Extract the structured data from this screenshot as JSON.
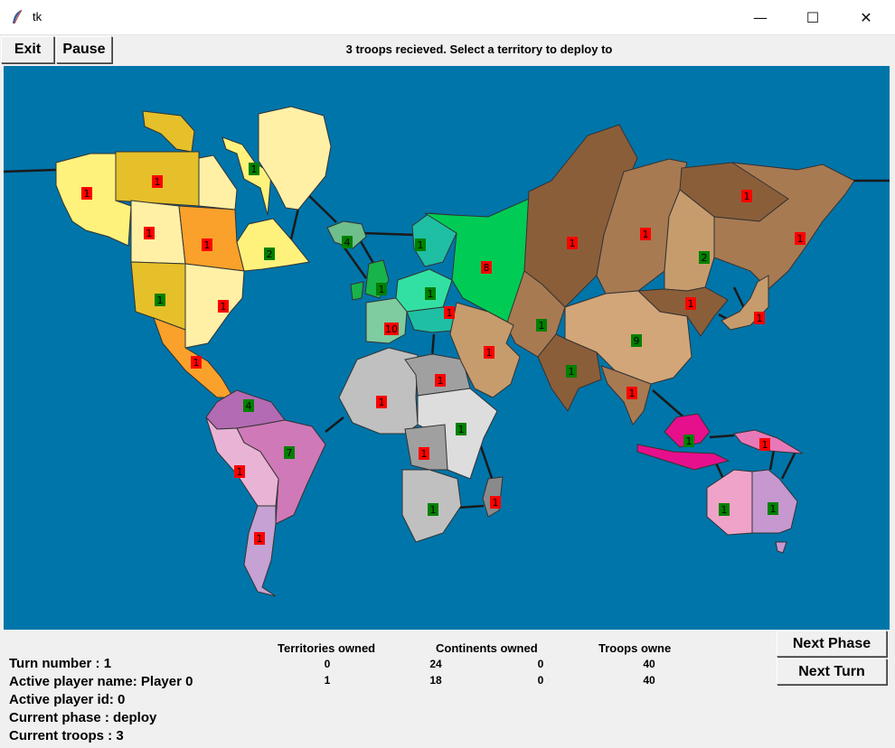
{
  "window": {
    "title": "tk",
    "minimize_symbol": "—",
    "maximize_symbol": "☐",
    "close_symbol": "✕"
  },
  "toolbar": {
    "exit_label": "Exit",
    "pause_label": "Pause",
    "status_message": "3 troops recieved. Select a territory to deploy to"
  },
  "map": {
    "ocean_color": "#0075aa",
    "badge_colors": {
      "red": "#ff0000",
      "green": "#008000"
    },
    "armies": [
      {
        "id": "alaska",
        "count": "1",
        "owner": "red"
      },
      {
        "id": "northwest-territory",
        "count": "1",
        "owner": "red"
      },
      {
        "id": "greenland",
        "count": "1",
        "owner": "green"
      },
      {
        "id": "alberta",
        "count": "1",
        "owner": "red"
      },
      {
        "id": "ontario",
        "count": "1",
        "owner": "red"
      },
      {
        "id": "quebec",
        "count": "2",
        "owner": "green"
      },
      {
        "id": "western-us",
        "count": "1",
        "owner": "green"
      },
      {
        "id": "eastern-us",
        "count": "1",
        "owner": "red"
      },
      {
        "id": "central-america",
        "count": "1",
        "owner": "red"
      },
      {
        "id": "iceland",
        "count": "4",
        "owner": "green"
      },
      {
        "id": "scandinavia",
        "count": "1",
        "owner": "green"
      },
      {
        "id": "great-britain",
        "count": "1",
        "owner": "green"
      },
      {
        "id": "northern-europe",
        "count": "1",
        "owner": "green"
      },
      {
        "id": "western-europe",
        "count": "10",
        "owner": "red"
      },
      {
        "id": "southern-europe",
        "count": "1",
        "owner": "red"
      },
      {
        "id": "ukraine",
        "count": "8",
        "owner": "red"
      },
      {
        "id": "ural",
        "count": "1",
        "owner": "red"
      },
      {
        "id": "siberia",
        "count": "1",
        "owner": "red"
      },
      {
        "id": "yakutsk",
        "count": "1",
        "owner": "red"
      },
      {
        "id": "kamchatka",
        "count": "1",
        "owner": "red"
      },
      {
        "id": "irkutsk",
        "count": "2",
        "owner": "green"
      },
      {
        "id": "mongolia",
        "count": "1",
        "owner": "red"
      },
      {
        "id": "japan",
        "count": "1",
        "owner": "red"
      },
      {
        "id": "afghanistan",
        "count": "1",
        "owner": "green"
      },
      {
        "id": "china",
        "count": "9",
        "owner": "green"
      },
      {
        "id": "middle-east",
        "count": "1",
        "owner": "red"
      },
      {
        "id": "india",
        "count": "1",
        "owner": "green"
      },
      {
        "id": "siam",
        "count": "1",
        "owner": "red"
      },
      {
        "id": "venezuela",
        "count": "4",
        "owner": "green"
      },
      {
        "id": "brazil",
        "count": "7",
        "owner": "green"
      },
      {
        "id": "peru",
        "count": "1",
        "owner": "red"
      },
      {
        "id": "argentina",
        "count": "1",
        "owner": "red"
      },
      {
        "id": "north-africa",
        "count": "1",
        "owner": "red"
      },
      {
        "id": "egypt",
        "count": "1",
        "owner": "red"
      },
      {
        "id": "east-africa",
        "count": "1",
        "owner": "green"
      },
      {
        "id": "congo",
        "count": "1",
        "owner": "red"
      },
      {
        "id": "south-africa",
        "count": "1",
        "owner": "green"
      },
      {
        "id": "madagascar",
        "count": "1",
        "owner": "red"
      },
      {
        "id": "indonesia",
        "count": "1",
        "owner": "green"
      },
      {
        "id": "new-guinea",
        "count": "1",
        "owner": "red"
      },
      {
        "id": "western-australia",
        "count": "1",
        "owner": "green"
      },
      {
        "id": "eastern-australia",
        "count": "1",
        "owner": "green"
      }
    ]
  },
  "buttons": {
    "next_phase": "Next Phase",
    "next_turn": "Next Turn"
  },
  "game_info": {
    "turn": "Turn number : 1",
    "player_name": "Active player name: Player 0",
    "player_id": "Active player id: 0",
    "phase": "Current phase : deploy",
    "troops": "Current troops : 3"
  },
  "stats": {
    "headers": [
      "Territories owned",
      "Continents owned",
      "Troops owne"
    ],
    "rows": [
      [
        "0",
        "24",
        "0",
        "40"
      ],
      [
        "1",
        "18",
        "0",
        "40"
      ]
    ]
  }
}
